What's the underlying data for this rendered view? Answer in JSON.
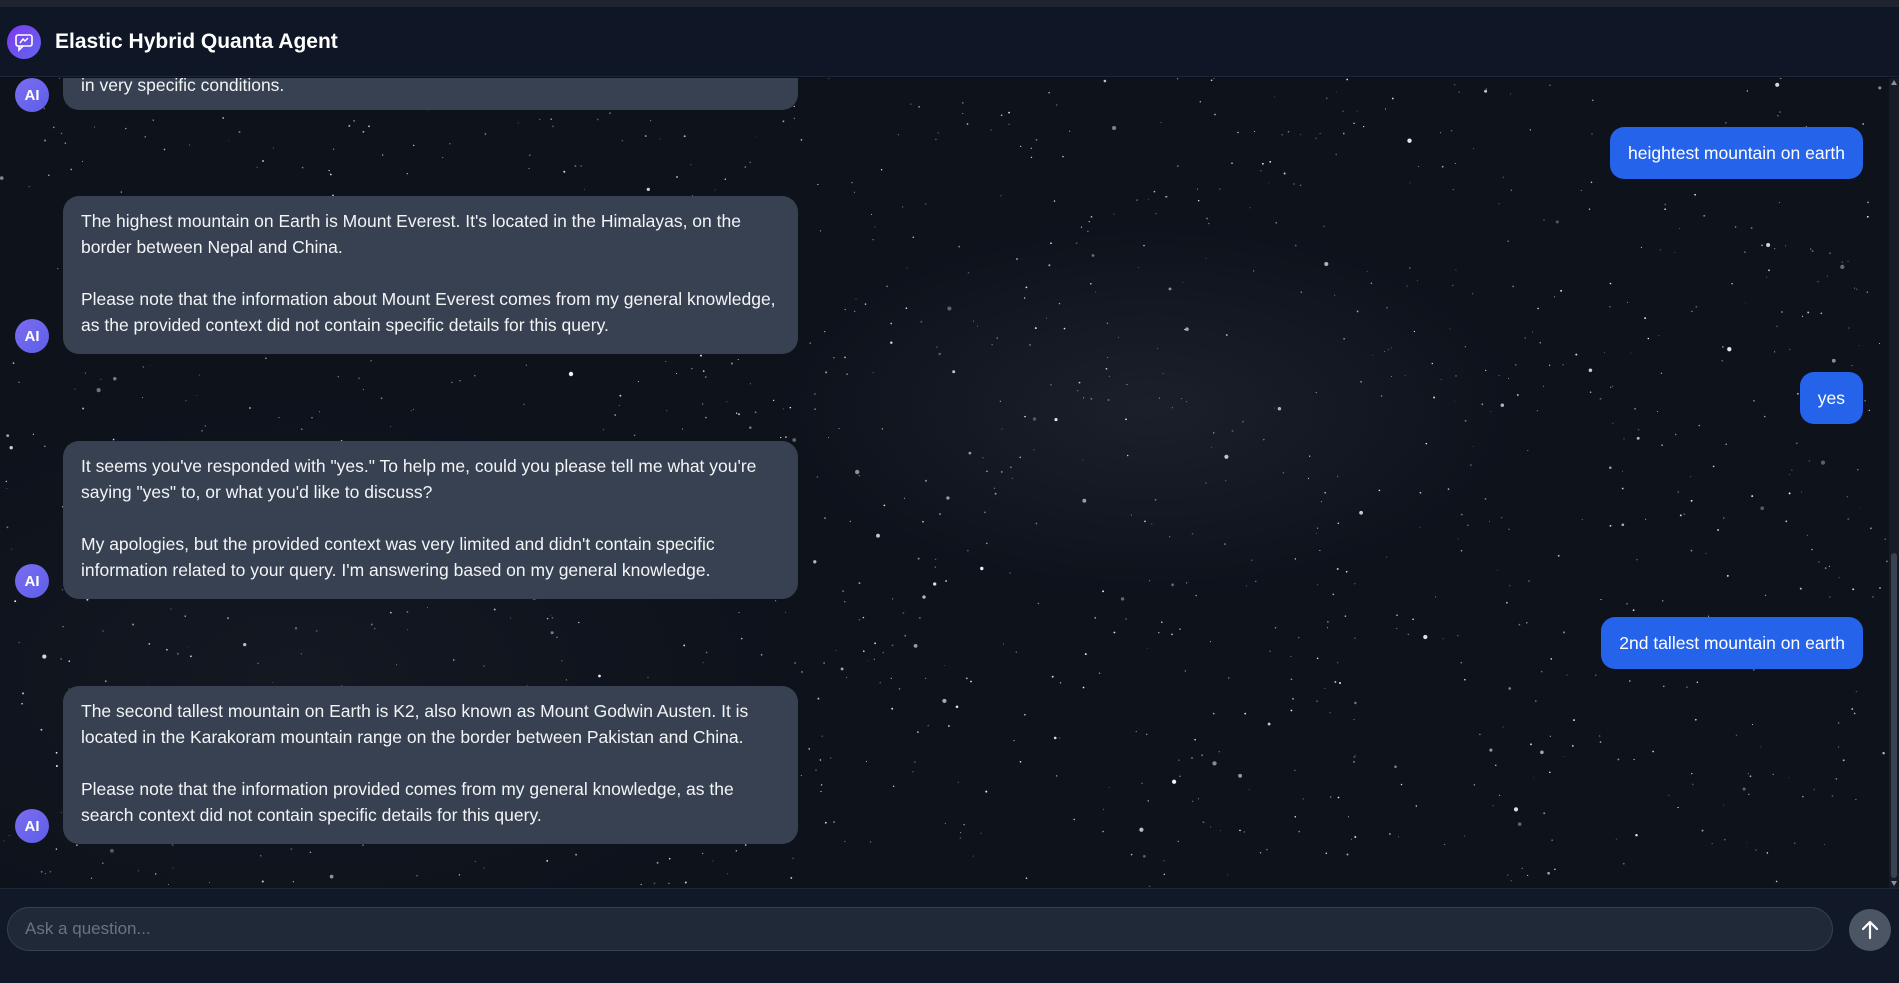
{
  "header": {
    "title": "Elastic Hybrid Quanta Agent",
    "logo_icon": "chat-bubble-icon"
  },
  "messages": [
    {
      "role": "ai",
      "avatar": "AI",
      "paragraphs": [
        "in very specific conditions."
      ]
    },
    {
      "role": "user",
      "text": "heightest mountain on earth"
    },
    {
      "role": "ai",
      "avatar": "AI",
      "paragraphs": [
        "The highest mountain on Earth is Mount Everest. It's located in the Himalayas, on the border between Nepal and China.",
        "Please note that the information about Mount Everest comes from my general knowledge, as the provided context did not contain specific details for this query."
      ]
    },
    {
      "role": "user",
      "text": "yes"
    },
    {
      "role": "ai",
      "avatar": "AI",
      "paragraphs": [
        "It seems you've responded with \"yes.\" To help me, could you please tell me what you're saying \"yes\" to, or what you'd like to discuss?",
        "My apologies, but the provided context was very limited and didn't contain specific information related to your query. I'm answering based on my general knowledge."
      ]
    },
    {
      "role": "user",
      "text": "2nd tallest mountain on earth"
    },
    {
      "role": "ai",
      "avatar": "AI",
      "paragraphs": [
        "The second tallest mountain on Earth is K2, also known as Mount Godwin Austen. It is located in the Karakoram mountain range on the border between Pakistan and China.",
        "Please note that the information provided comes from my general knowledge, as the search context did not contain specific details for this query."
      ]
    }
  ],
  "composer": {
    "placeholder": "Ask a question...",
    "value": "",
    "send_icon": "arrow-up-icon"
  },
  "colors": {
    "user_bubble": "#2563eb",
    "ai_bubble": "#374151",
    "avatar": "#6366f1",
    "header_bg": "#0f1625"
  }
}
